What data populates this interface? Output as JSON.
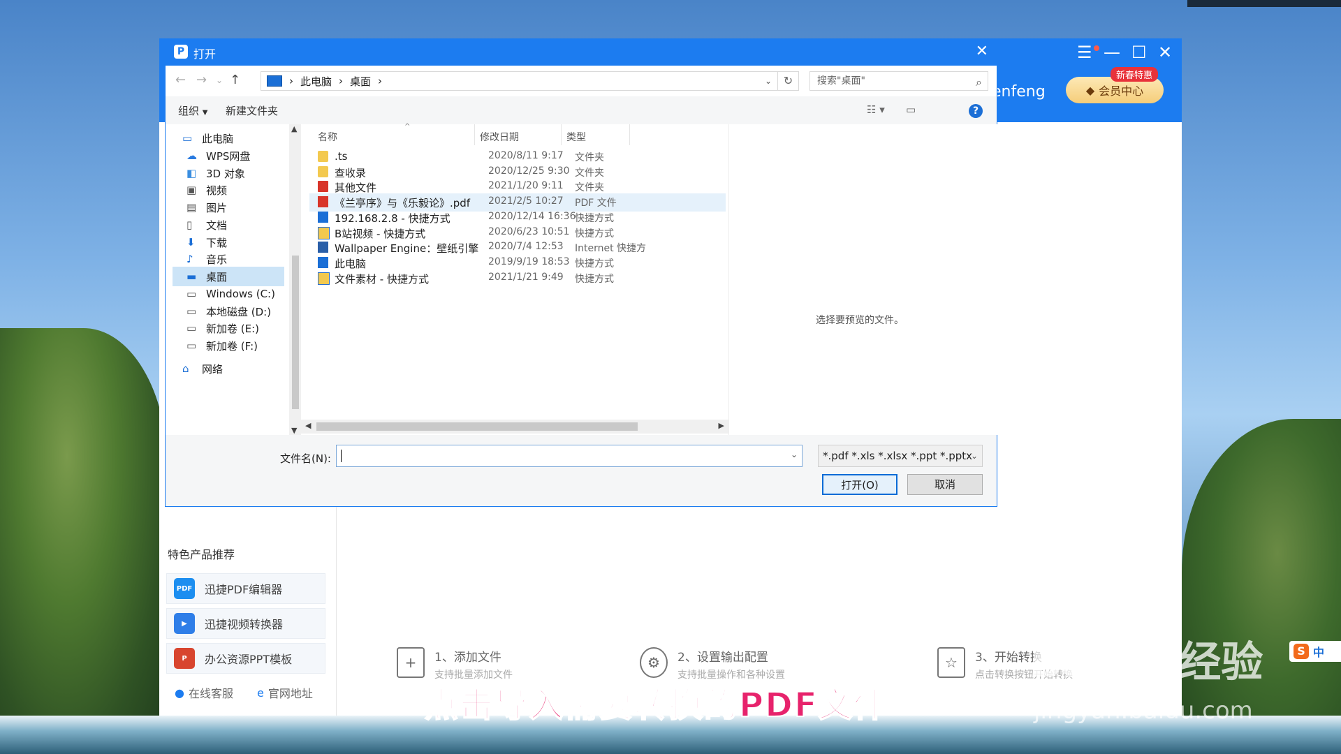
{
  "dialog": {
    "title": "打开",
    "breadcrumb": [
      "此电脑",
      "桌面"
    ],
    "search_placeholder": "搜索\"桌面\"",
    "toolbar": {
      "organize": "组织",
      "new_folder": "新建文件夹"
    },
    "tree": [
      {
        "label": "此电脑",
        "icon": "computer-icon"
      },
      {
        "label": "WPS网盘",
        "icon": "cloud-icon"
      },
      {
        "label": "3D 对象",
        "icon": "cube-icon"
      },
      {
        "label": "视频",
        "icon": "video-icon"
      },
      {
        "label": "图片",
        "icon": "picture-icon"
      },
      {
        "label": "文档",
        "icon": "document-icon"
      },
      {
        "label": "下载",
        "icon": "download-icon"
      },
      {
        "label": "音乐",
        "icon": "music-icon"
      },
      {
        "label": "桌面",
        "icon": "desktop-icon",
        "selected": true
      },
      {
        "label": "Windows (C:)",
        "icon": "drive-icon"
      },
      {
        "label": "本地磁盘 (D:)",
        "icon": "drive-icon"
      },
      {
        "label": "新加卷 (E:)",
        "icon": "drive-icon"
      },
      {
        "label": "新加卷 (F:)",
        "icon": "drive-icon"
      },
      {
        "label": "网络",
        "icon": "network-icon"
      }
    ],
    "columns": {
      "name": "名称",
      "date": "修改日期",
      "type": "类型"
    },
    "files": [
      {
        "name": ".ts",
        "date": "2020/8/11 9:17",
        "type": "文件夹",
        "icon": "folder-icon"
      },
      {
        "name": "查收录",
        "date": "2020/12/25 9:30",
        "type": "文件夹",
        "icon": "folder-icon"
      },
      {
        "name": "其他文件",
        "date": "2021/1/20 9:11",
        "type": "文件夹",
        "icon": "red-folder-icon"
      },
      {
        "name": "《兰亭序》与《乐毅论》.pdf",
        "date": "2021/2/5 10:27",
        "type": "PDF 文件",
        "icon": "pdf-icon",
        "highlight": true
      },
      {
        "name": "192.168.2.8 - 快捷方式",
        "date": "2020/12/14 16:36",
        "type": "快捷方式",
        "icon": "shortcut-icon"
      },
      {
        "name": "B站视频 - 快捷方式",
        "date": "2020/6/23 10:51",
        "type": "快捷方式",
        "icon": "folder-shortcut-icon"
      },
      {
        "name": "Wallpaper Engine：壁纸引擎",
        "date": "2020/7/4 12:53",
        "type": "Internet 快捷方",
        "icon": "internet-shortcut-icon"
      },
      {
        "name": "此电脑",
        "date": "2019/9/19 18:53",
        "type": "快捷方式",
        "icon": "computer-shortcut-icon"
      },
      {
        "name": "文件素材 - 快捷方式",
        "date": "2021/1/21 9:49",
        "type": "快捷方式",
        "icon": "folder-shortcut-icon"
      }
    ],
    "preview_text": "选择要预览的文件。",
    "filename_label": "文件名(N):",
    "filename_value": "",
    "file_type": "*.pdf *.xls *.xlsx *.ppt *.pptx",
    "open_button": "打开(O)",
    "cancel_button": "取消"
  },
  "app": {
    "user_partial": "enfeng",
    "vip_label": "会员中心",
    "vip_badge": "新春特惠",
    "products_title": "特色产品推荐",
    "products": [
      {
        "label": "迅捷PDF编辑器",
        "icon_text": "PDF",
        "color": "#1c8ef0"
      },
      {
        "label": "迅捷视频转换器",
        "icon_text": "▶",
        "color": "#2f7ee8"
      },
      {
        "label": "办公资源PPT模板",
        "icon_text": "P",
        "color": "#d8452e"
      }
    ],
    "footer_links": [
      "在线客服",
      "官网地址"
    ],
    "steps": [
      {
        "title": "1、添加文件",
        "sub": "支持批量添加文件"
      },
      {
        "title": "2、设置输出配置",
        "sub": "支持批量操作和各种设置"
      },
      {
        "title": "3、开始转换",
        "sub": "点击转换按钮开始转换"
      }
    ]
  },
  "overlay": {
    "caption": "点击导入需要转换的PDF文件",
    "watermark_main": "Baidu 经验",
    "watermark_url": "jingyan.baidu.com",
    "ime": "中"
  },
  "colors": {
    "accent": "#1c7cf0",
    "caption": "#e7236c"
  }
}
